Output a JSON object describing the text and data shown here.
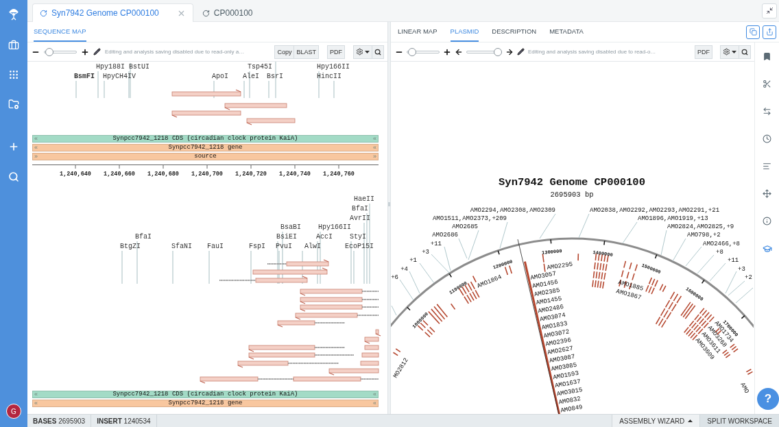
{
  "user": {
    "initial": "G"
  },
  "document_tabs": [
    {
      "label": "Syn7942 Genome CP000100",
      "selected": true
    },
    {
      "label": "CP000100",
      "selected": false
    }
  ],
  "left_panel": {
    "tabs": [
      {
        "label": "SEQUENCE MAP",
        "selected": true
      }
    ],
    "toolbar": {
      "zoom": {
        "level": 0.05
      },
      "notice": "Editing and analysis saving disabled due to read-only a…",
      "button_groups": [
        [
          "Copy",
          "BLAST"
        ],
        [
          "PDF"
        ]
      ]
    },
    "blocks": [
      {
        "enzymes": [
          {
            "name": "Hpy188I",
            "bold": false
          },
          {
            "name": "BstUI",
            "bold": false
          },
          {
            "name": "Tsp45I",
            "bold": false
          },
          {
            "name": "Hpy166II",
            "bold": false
          },
          {
            "name": "BsmFI",
            "bold": true
          },
          {
            "name": "HpyCH4IV",
            "bold": false
          },
          {
            "name": "ApoI",
            "bold": false
          },
          {
            "name": "AleI",
            "bold": false
          },
          {
            "name": "BsrI",
            "bold": false
          },
          {
            "name": "HincII",
            "bold": false
          }
        ],
        "features": [
          {
            "label": "Synpcc7942_1218 CDS (circadian clock protein KaiA)",
            "color": "#a3dbc6",
            "ends": "«"
          },
          {
            "label": "Synpcc7942_1218 gene",
            "color": "#f8c79f",
            "ends": "«"
          },
          {
            "label": "source",
            "color": "#f8c79f",
            "ends": "»"
          }
        ],
        "ruler": [
          "1,240,640",
          "1,240,660",
          "1,240,680",
          "1,240,700",
          "1,240,720",
          "1,240,740",
          "1,240,760"
        ]
      },
      {
        "enzymes": [
          {
            "name": "HaeII",
            "bold": false
          },
          {
            "name": "BfaI",
            "bold": false
          },
          {
            "name": "AvrII",
            "bold": false
          },
          {
            "name": "BsaBI",
            "bold": false
          },
          {
            "name": "Hpy166II",
            "bold": false
          },
          {
            "name": "BfaI",
            "bold": false
          },
          {
            "name": "BsiEI",
            "bold": false
          },
          {
            "name": "AccI",
            "bold": false
          },
          {
            "name": "StyI",
            "bold": false
          },
          {
            "name": "BtgZI",
            "bold": false
          },
          {
            "name": "SfaNI",
            "bold": false
          },
          {
            "name": "FauI",
            "bold": false
          },
          {
            "name": "FspI",
            "bold": false
          },
          {
            "name": "PvuI",
            "bold": false
          },
          {
            "name": "AlwI",
            "bold": false
          },
          {
            "name": "EcoP15I",
            "bold": false
          }
        ],
        "features": [
          {
            "label": "Synpcc7942_1218 CDS (circadian clock protein KaiA)",
            "color": "#a3dbc6",
            "ends": "«"
          },
          {
            "label": "Synpcc7942_1218 gene",
            "color": "#f8c79f",
            "ends": "«"
          }
        ]
      }
    ]
  },
  "right_panel": {
    "tabs": [
      {
        "label": "LINEAR MAP",
        "selected": false
      },
      {
        "label": "PLASMID",
        "selected": true
      },
      {
        "label": "DESCRIPTION",
        "selected": false
      },
      {
        "label": "METADATA",
        "selected": false
      }
    ],
    "toolbar": {
      "zoom": {
        "level": 0.05
      },
      "rotation": {
        "level": 1
      },
      "notice": "Editing and analysis saving disabled due to read-o…",
      "button_groups": [
        [
          "PDF"
        ]
      ]
    },
    "plasmid": {
      "title": "Syn7942 Genome CP000100",
      "length": "2695903 bp",
      "ticks": [
        "1000000",
        "1100000",
        "1200000",
        "1300000",
        "1400000",
        "1500000",
        "1600000",
        "1700000"
      ],
      "outer_labels": [
        "AMO2294,AMO2308,AMO2309",
        "AMO1511,AMO2373,+209",
        "AMO2685",
        "AMO2686",
        "+11",
        "+3",
        "+1",
        "+4",
        "+6",
        "AMO2038,AMO2292,AMO2293,AMO2291,+21",
        "AMO1896,AMO1919,+13",
        "AMO2824,AMO2825,+9",
        "AMO798,+2",
        "AMO2466,+8",
        "+8",
        "+11",
        "+3",
        "+2"
      ],
      "cursor_labels": [
        "AMO3057",
        "AMO1456",
        "AMO2385",
        "AMO1455",
        "AMO2486",
        "AMO3074",
        "AMO1833",
        "AMO3072",
        "AMO2396",
        "AMO2627",
        "AMO3087",
        "AMO3085",
        "AMO1593",
        "AMO1637",
        "AMO3015",
        "AMO832",
        "AMO849"
      ],
      "inner_labels": [
        "AMO2295",
        "AMO1864",
        "AMO1885",
        "AMO1867",
        "AMO1734",
        "AMO3268",
        "AMO3611",
        "AMO3609",
        "MO2812",
        "AMO"
      ]
    }
  },
  "status_bar": {
    "bases": "**BASES** 2695903",
    "insert": "**INSERT** 1240534",
    "buttons": [
      {
        "label": "ASSEMBLY WIZARD",
        "menu": true,
        "selected": false
      },
      {
        "label": "SPLIT WORKSPACE",
        "menu": false,
        "selected": true
      }
    ]
  },
  "help": "?"
}
